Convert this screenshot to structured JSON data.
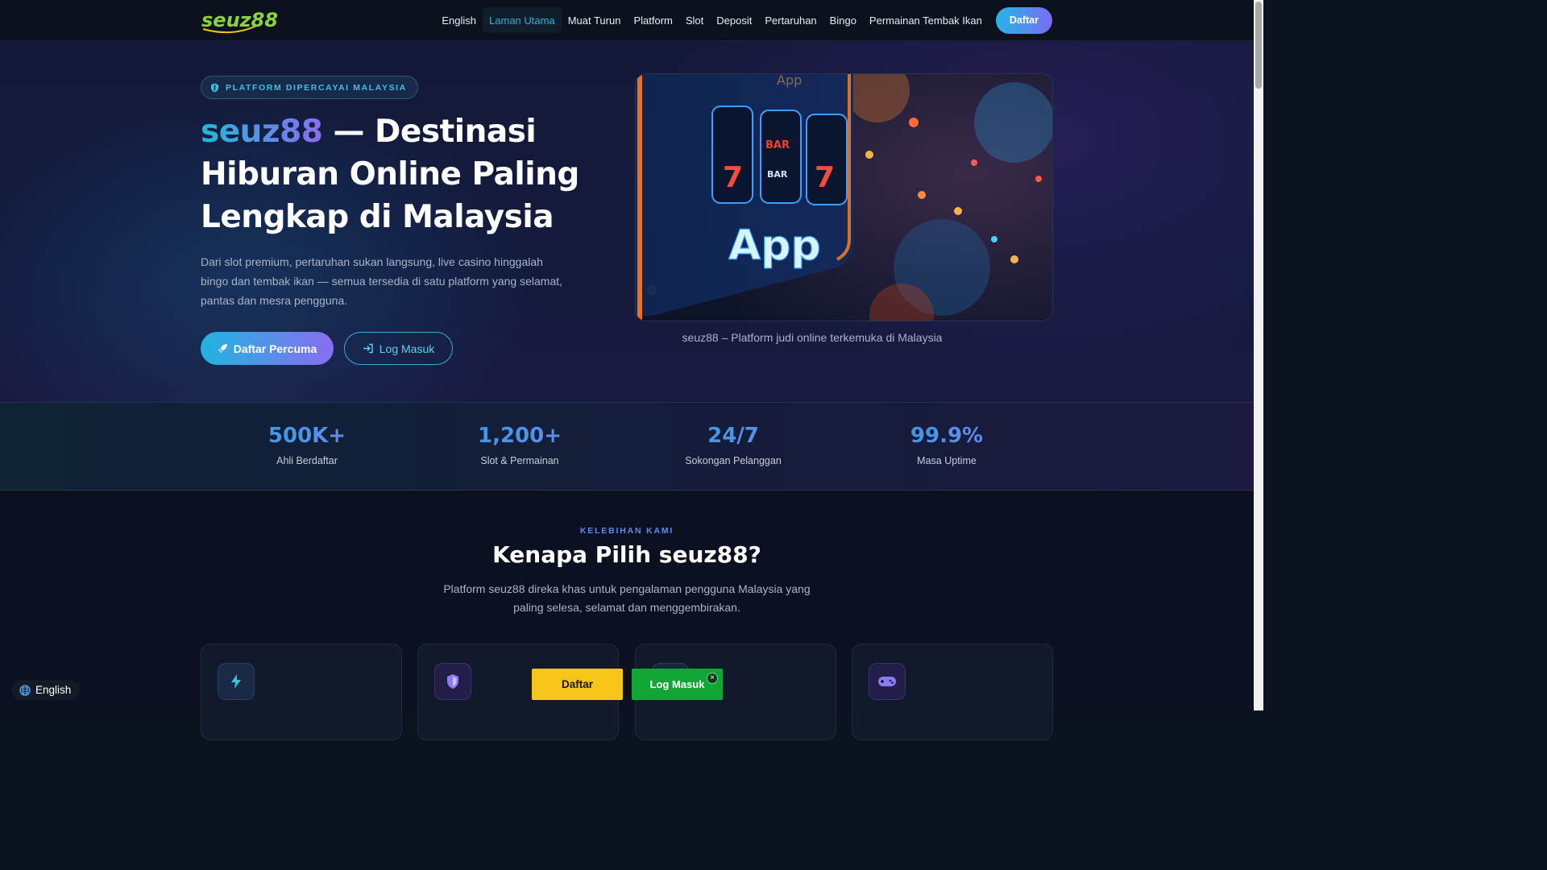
{
  "header": {
    "logo_text": "seuz88",
    "nav": [
      {
        "label": "English"
      },
      {
        "label": "Laman Utama"
      },
      {
        "label": "Muat Turun"
      },
      {
        "label": "Platform"
      },
      {
        "label": "Slot"
      },
      {
        "label": "Deposit"
      },
      {
        "label": "Pertaruhan"
      },
      {
        "label": "Bingo"
      },
      {
        "label": "Permainan Tembak Ikan"
      }
    ],
    "active_nav": "Laman Utama",
    "cta_label": "Daftar"
  },
  "hero": {
    "badge": "PLATFORM DIPERCAYAI MALAYSIA",
    "title_brand": "seuz88",
    "title_rest": " — Destinasi Hiburan Online Paling Lengkap di Malaysia",
    "description": "Dari slot premium, pertaruhan sukan langsung, live casino hinggalah bingo dan tembak ikan — semua tersedia di satu platform yang selamat, pantas dan mesra pengguna.",
    "primary_button": "Daftar Percuma",
    "secondary_button": "Log Masuk",
    "image_text_top": "App",
    "image_text_main": "App",
    "image_reel_labels": [
      "7",
      "BAR",
      "BAR",
      "7"
    ],
    "image_caption": "seuz88 – Platform judi online terkemuka di Malaysia"
  },
  "stats": [
    {
      "value": "500K+",
      "label": "Ahli Berdaftar"
    },
    {
      "value": "1,200+",
      "label": "Slot & Permainan"
    },
    {
      "value": "24/7",
      "label": "Sokongan Pelanggan"
    },
    {
      "value": "99.9%",
      "label": "Masa Uptime"
    }
  ],
  "features": {
    "kicker": "KELEBIHAN KAMI",
    "title": "Kenapa Pilih seuz88?",
    "description": "Platform seuz88 direka khas untuk pengalaman pengguna Malaysia yang paling selesa, selamat dan menggembirakan.",
    "cards": [
      {
        "icon": "lightning-icon"
      },
      {
        "icon": "shield-icon"
      },
      {
        "icon": "card-icon"
      },
      {
        "icon": "gamepad-icon"
      }
    ]
  },
  "floating": {
    "language": "English",
    "register": "Daftar",
    "login": "Log Masuk",
    "close": "×"
  },
  "colors": {
    "accent_cyan": "#1fb6d6",
    "accent_purple": "#8a6cf0",
    "float_yellow": "#f5c518",
    "float_green": "#12a637"
  }
}
